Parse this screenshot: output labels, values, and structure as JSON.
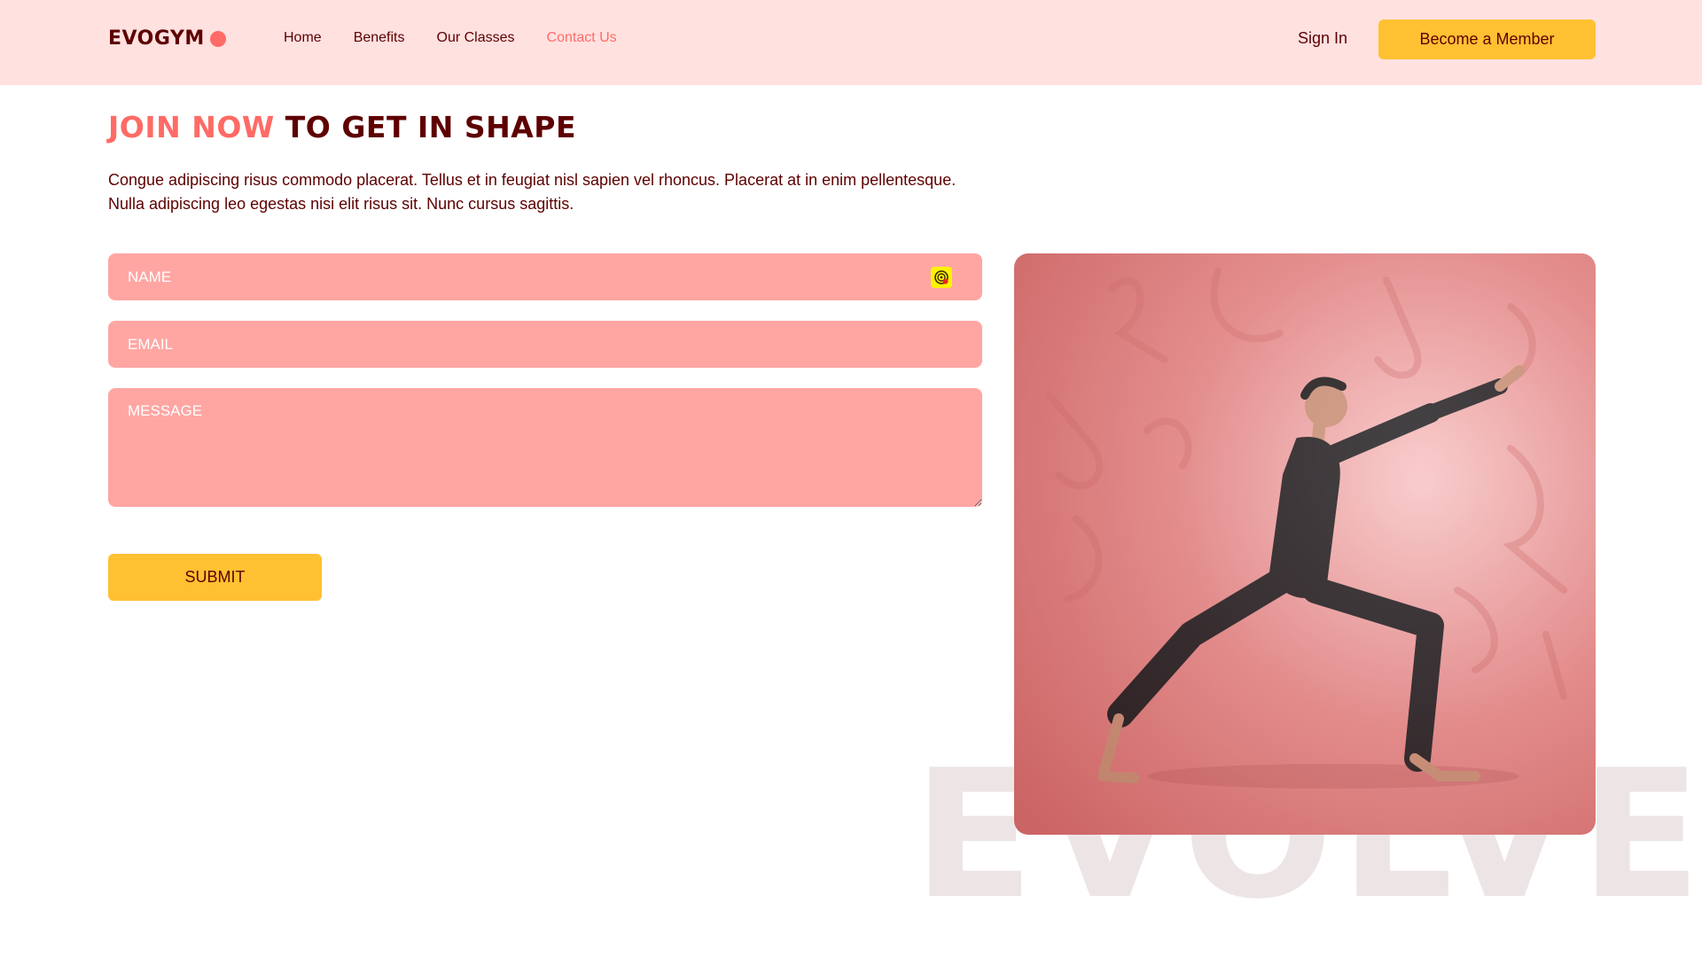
{
  "header": {
    "logo_text": "EVOGYM",
    "nav": [
      {
        "label": "Home",
        "active": false
      },
      {
        "label": "Benefits",
        "active": false
      },
      {
        "label": "Our Classes",
        "active": false
      },
      {
        "label": "Contact Us",
        "active": true
      }
    ],
    "sign_in": "Sign In",
    "member_button": "Become a Member"
  },
  "hero": {
    "heading_accent": "JOIN NOW",
    "heading_rest": " TO GET IN SHAPE",
    "intro": "Congue adipiscing risus commodo placerat. Tellus et in feugiat nisl sapien vel rhoncus. Placerat at in enim pellentesque. Nulla adipiscing leo egestas nisi elit risus sit. Nunc cursus sagittis."
  },
  "form": {
    "name_placeholder": "NAME",
    "email_placeholder": "EMAIL",
    "message_placeholder": "MESSAGE",
    "submit": "SUBMIT",
    "name_field_icon": "autofill-icon"
  },
  "watermark": "EVOLVE",
  "colors": {
    "primary": "#5e0000",
    "accent": "#ff6b66",
    "secondary": "#ffc132",
    "nav_bg": "#ffe1e0",
    "field_bg": "#ffa6a3"
  },
  "image": {
    "subject": "man in black outfit doing a lunge stretch on a pink background"
  }
}
